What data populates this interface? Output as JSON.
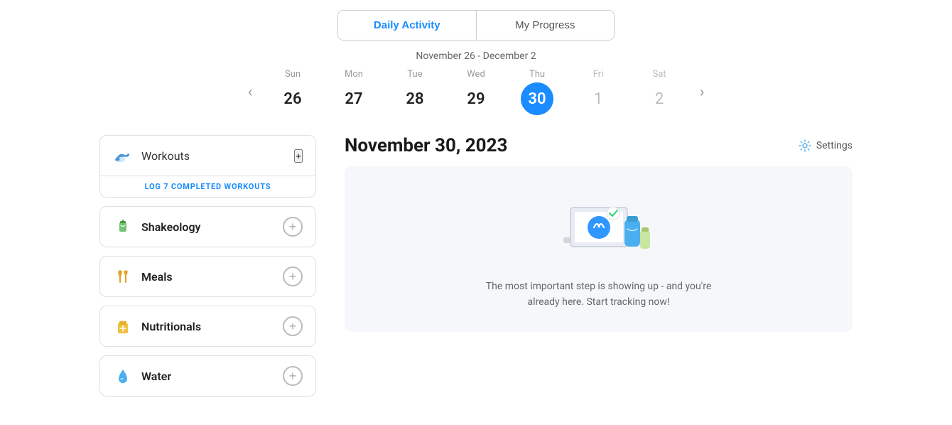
{
  "tabs": {
    "daily_activity": "Daily Activity",
    "my_progress": "My Progress",
    "active": "daily_activity"
  },
  "calendar": {
    "date_range": "November 26 - December 2",
    "days": [
      {
        "name": "Sun",
        "num": "26",
        "today": false,
        "faded": false
      },
      {
        "name": "Mon",
        "num": "27",
        "today": false,
        "faded": false
      },
      {
        "name": "Tue",
        "num": "28",
        "today": false,
        "faded": false
      },
      {
        "name": "Wed",
        "num": "29",
        "today": false,
        "faded": false
      },
      {
        "name": "Thu",
        "num": "30",
        "today": true,
        "faded": false
      },
      {
        "name": "Fri",
        "num": "1",
        "today": false,
        "faded": true
      },
      {
        "name": "Sat",
        "num": "2",
        "today": false,
        "faded": true
      }
    ]
  },
  "left_panel": {
    "workouts": {
      "label": "Workouts",
      "log_link": "LOG 7 COMPLETED WORKOUTS"
    },
    "shakeology": {
      "label": "Shakeology"
    },
    "meals": {
      "label": "Meals"
    },
    "nutritionals": {
      "label": "Nutritionals"
    },
    "water": {
      "label": "Water"
    }
  },
  "right_panel": {
    "date_title": "November 30, 2023",
    "settings_label": "Settings",
    "empty_state_text": "The most important step is showing up - and you're already here. Start tracking now!"
  },
  "colors": {
    "accent": "#1a8cff",
    "today_bg": "#1a8cff",
    "border": "#e0e0e0",
    "faded": "#bbb"
  }
}
